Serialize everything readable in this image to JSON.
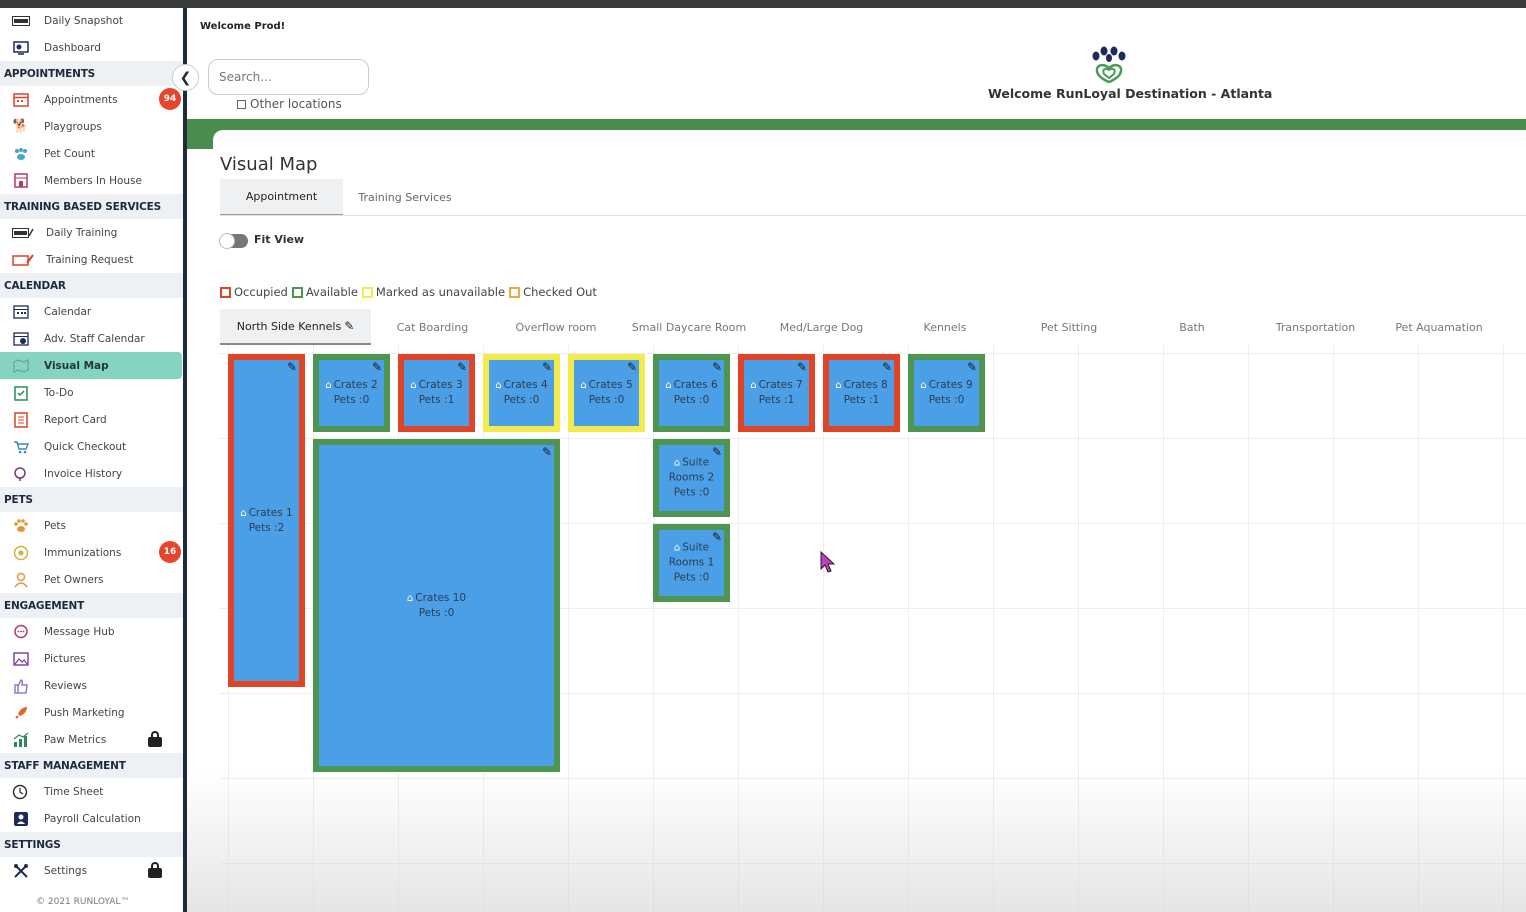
{
  "sidebar": {
    "top_items": [
      {
        "label": "Daily Snapshot",
        "icon": "today-icon"
      },
      {
        "label": "Dashboard",
        "icon": "dashboard-icon"
      }
    ],
    "sections": [
      {
        "title": "APPOINTMENTS",
        "items": [
          {
            "label": "Appointments",
            "icon": "calendar-icon",
            "badge": "94"
          },
          {
            "label": "Playgroups",
            "icon": "dog-play-icon"
          },
          {
            "label": "Pet Count",
            "icon": "paw-group-icon"
          },
          {
            "label": "Members In House",
            "icon": "house-icon"
          }
        ]
      },
      {
        "title": "TRAINING BASED SERVICES",
        "items": [
          {
            "label": "Daily Training",
            "icon": "training-icon"
          },
          {
            "label": "Training Request",
            "icon": "request-icon"
          }
        ]
      },
      {
        "title": "CALENDAR",
        "items": [
          {
            "label": "Calendar",
            "icon": "calendar-icon"
          },
          {
            "label": "Adv. Staff Calendar",
            "icon": "staff-calendar-icon"
          },
          {
            "label": "Visual Map",
            "icon": "map-icon",
            "active": true
          },
          {
            "label": "To-Do",
            "icon": "todo-icon"
          },
          {
            "label": "Report Card",
            "icon": "report-card-icon"
          },
          {
            "label": "Quick Checkout",
            "icon": "cart-icon"
          },
          {
            "label": "Invoice History",
            "icon": "invoice-icon"
          }
        ]
      },
      {
        "title": "PETS",
        "items": [
          {
            "label": "Pets",
            "icon": "paw-icon"
          },
          {
            "label": "Immunizations",
            "icon": "shield-icon",
            "badge": "16"
          },
          {
            "label": "Pet Owners",
            "icon": "person-icon"
          }
        ]
      },
      {
        "title": "ENGAGEMENT",
        "items": [
          {
            "label": "Message Hub",
            "icon": "chat-icon"
          },
          {
            "label": "Pictures",
            "icon": "picture-icon"
          },
          {
            "label": "Reviews",
            "icon": "thumbs-up-icon"
          },
          {
            "label": "Push Marketing",
            "icon": "rocket-icon"
          },
          {
            "label": "Paw Metrics",
            "icon": "metrics-icon",
            "locked": true
          }
        ]
      },
      {
        "title": "STAFF MANAGEMENT",
        "items": [
          {
            "label": "Time Sheet",
            "icon": "clock-icon"
          },
          {
            "label": "Payroll Calculation",
            "icon": "payroll-icon"
          }
        ]
      },
      {
        "title": "SETTINGS",
        "items": [
          {
            "label": "Settings",
            "icon": "tools-icon",
            "locked": true
          }
        ]
      }
    ],
    "footer": "© 2021 RUNLOYAL™"
  },
  "header": {
    "welcome_user": "Welcome Prod!",
    "search_placeholder": "Search...",
    "other_locations": "Other locations",
    "brand_title": "Welcome RunLoyal Destination - Atlanta"
  },
  "main": {
    "title": "Visual Map",
    "tabs": [
      "Appointment",
      "Training Services"
    ],
    "active_tab": "Appointment",
    "fit_view_label": "Fit View",
    "legend": [
      {
        "label": "Occupied",
        "color": "#df4427"
      },
      {
        "label": "Available",
        "color": "#4f9552"
      },
      {
        "label": "Marked as unavailable",
        "color": "#f3ea4d"
      },
      {
        "label": "Checked Out",
        "color": "#f0a93b"
      }
    ],
    "room_tabs": [
      "North Side Kennels",
      "Cat Boarding",
      "Overflow room",
      "Small Daycare Room",
      "Med/Large Dog",
      "Kennels",
      "Pet Sitting",
      "Bath",
      "Transportation",
      "Pet Aquamation"
    ],
    "active_room_tab": "North Side Kennels",
    "rooms": [
      {
        "name": "Crates 1",
        "pets": "Pets :2",
        "status": "occupied"
      },
      {
        "name": "Crates 2",
        "pets": "Pets :0",
        "status": "available"
      },
      {
        "name": "Crates 3",
        "pets": "Pets :1",
        "status": "occupied"
      },
      {
        "name": "Crates 4",
        "pets": "Pets :0",
        "status": "unavailable"
      },
      {
        "name": "Crates 5",
        "pets": "Pets :0",
        "status": "unavailable"
      },
      {
        "name": "Crates 6",
        "pets": "Pets :0",
        "status": "available"
      },
      {
        "name": "Crates 7",
        "pets": "Pets :1",
        "status": "occupied"
      },
      {
        "name": "Crates 8",
        "pets": "Pets :1",
        "status": "occupied"
      },
      {
        "name": "Crates 9",
        "pets": "Pets :0",
        "status": "available"
      },
      {
        "name": "Crates 10",
        "pets": "Pets :0",
        "status": "available"
      },
      {
        "name": "Suite Rooms 2",
        "pets": "Pets :0",
        "status": "available"
      },
      {
        "name": "Suite Rooms 1",
        "pets": "Pets :0",
        "status": "available"
      }
    ]
  }
}
